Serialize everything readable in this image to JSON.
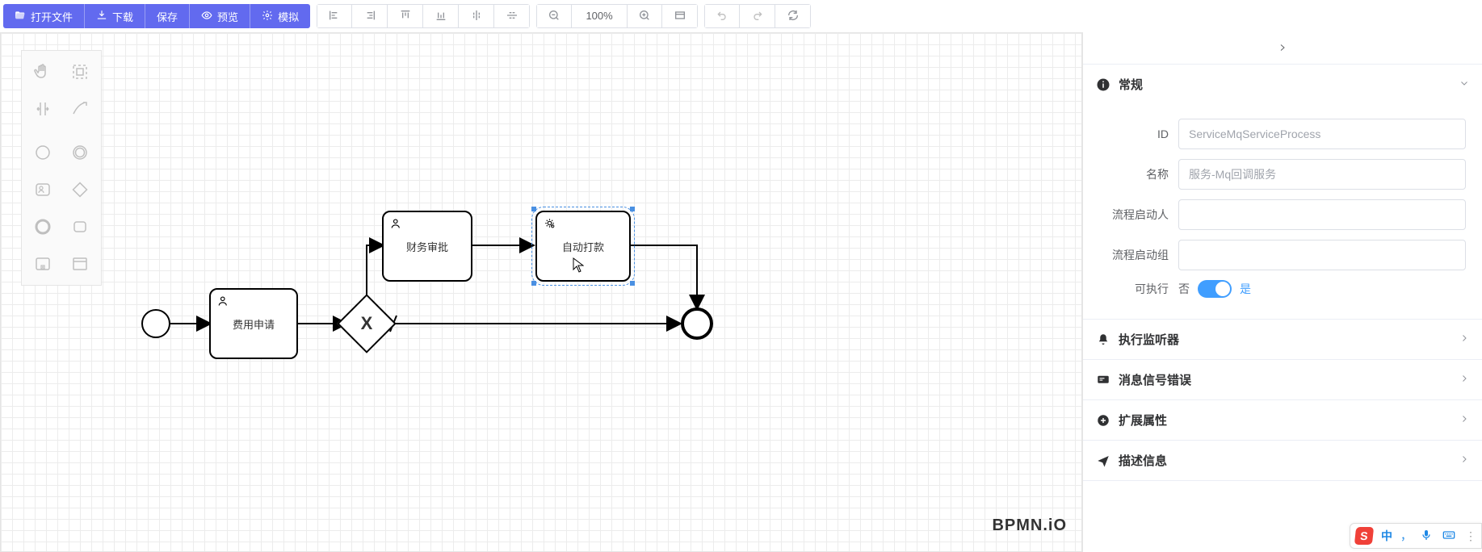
{
  "toolbar": {
    "open_label": "打开文件",
    "download_label": "下载",
    "save_label": "保存",
    "preview_label": "预览",
    "simulate_label": "模拟",
    "zoom_pct": "100%"
  },
  "palette": {
    "items": [
      {
        "name": "hand-tool-icon"
      },
      {
        "name": "lasso-tool-icon"
      },
      {
        "name": "space-tool-icon"
      },
      {
        "name": "connect-tool-icon"
      },
      {
        "name": "start-event-icon"
      },
      {
        "name": "intermediate-event-icon"
      },
      {
        "name": "user-task-icon"
      },
      {
        "name": "gateway-icon"
      },
      {
        "name": "end-event-icon"
      },
      {
        "name": "task-icon"
      },
      {
        "name": "subprocess-icon"
      },
      {
        "name": "data-object-icon"
      }
    ]
  },
  "diagram": {
    "start_event": {
      "name": "start-event"
    },
    "task1_label": "费用申请",
    "task2_label": "财务审批",
    "task3_label": "自动打款"
  },
  "side": {
    "sections": [
      {
        "icon": "info-icon",
        "label": "常规",
        "open": true
      },
      {
        "icon": "bell-icon",
        "label": "执行监听器",
        "open": false
      },
      {
        "icon": "message-icon",
        "label": "消息信号错误",
        "open": false
      },
      {
        "icon": "plus-circle-icon",
        "label": "扩展属性",
        "open": false
      },
      {
        "icon": "send-icon",
        "label": "描述信息",
        "open": false
      }
    ],
    "fields": {
      "id_label": "ID",
      "id_value": "ServiceMqServiceProcess",
      "name_label": "名称",
      "name_value": "服务-Mq回调服务",
      "start_user_label": "流程启动人",
      "start_user_value": "",
      "start_group_label": "流程启动组",
      "start_group_value": "",
      "exec_label": "可执行",
      "exec_no": "否",
      "exec_yes": "是",
      "exec_on": true
    }
  },
  "watermark": "BPMN.iO",
  "ime": {
    "lang": "中",
    "sep": "，"
  }
}
